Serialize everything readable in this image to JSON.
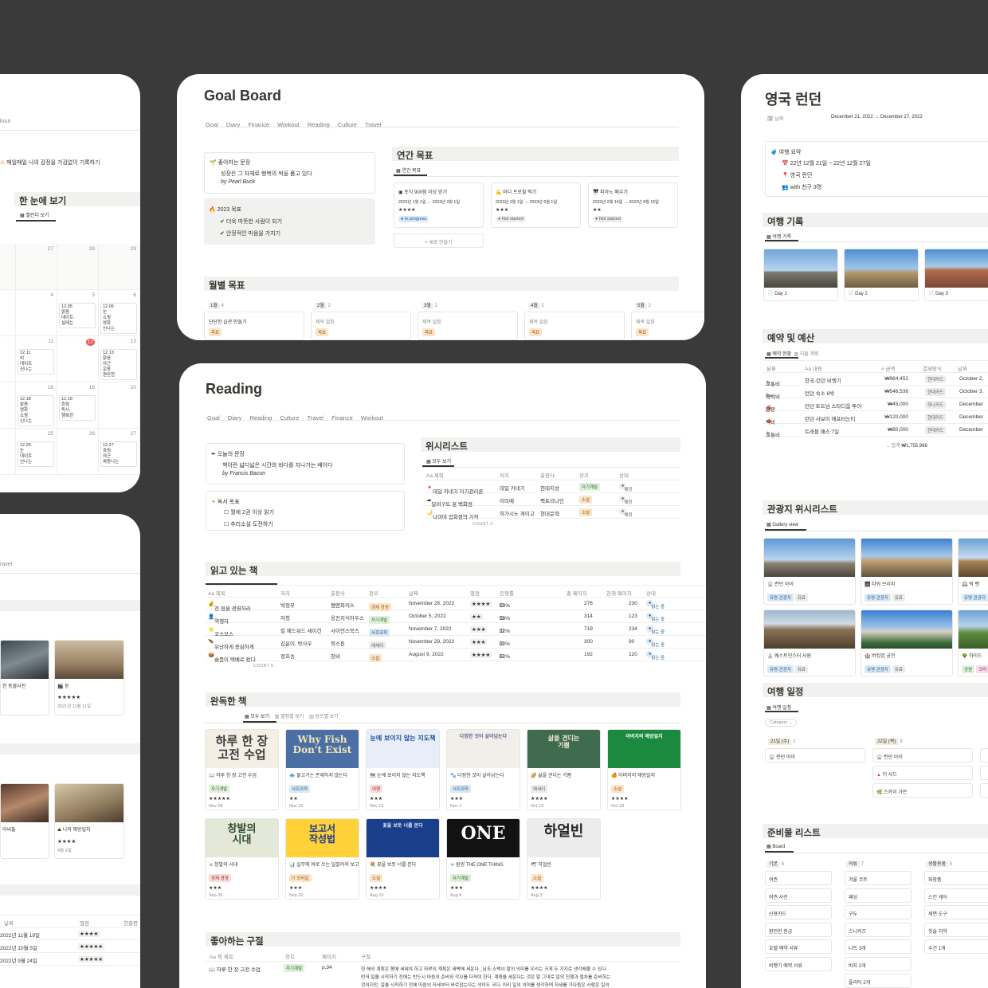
{
  "goal": {
    "title": "Goal Board",
    "tabs": [
      "Goal",
      "Diary",
      "Finance",
      "Workout",
      "Reading",
      "Culture",
      "Travel"
    ],
    "quote_title": "좋아하는 문장",
    "quote_text": "성장은 그 자체로 행복의 싹을 품고 있다",
    "quote_author": "by Pearl Buck",
    "goals_title": "2023 목표",
    "goals": [
      "더욱 따뜻한 사람이 되기",
      "안정적인 마음을 가지기"
    ],
    "annual_header": "연간 목표",
    "annual_view": "연간 목표",
    "annual_cards": [
      {
        "title": "토익 900점 이상 받기",
        "date": "2023년 1월 1일 → 2023년 3월 1일",
        "stars": "★★★★",
        "status": "In progress"
      },
      {
        "title": "바디 프로필 찍기",
        "date": "2023년 2월 1일 → 2023년 6월 1일",
        "stars": "★★★",
        "status": "Not started"
      },
      {
        "title": "피아노 배우기",
        "date": "2023년 2월 14일 → 2023년 8월 15일",
        "stars": "★★",
        "status": "Not started"
      }
    ],
    "new_label": "+ 새로 만들기",
    "monthly_header": "월별 목표",
    "months": [
      {
        "label": "1월",
        "count": "4",
        "item": "단단한 습관 만들기",
        "tag": "목표"
      },
      {
        "label": "2월",
        "count": "2",
        "item": "제목 없음",
        "tag": "목표"
      },
      {
        "label": "3월",
        "count": "2",
        "item": "제목 없음",
        "tag": "목표"
      },
      {
        "label": "4월",
        "count": "2",
        "item": "제목 없음",
        "tag": "목표"
      },
      {
        "label": "5월",
        "count": "2",
        "item": "제목 없음",
        "tag": "목표"
      }
    ]
  },
  "reading": {
    "title": "Reading",
    "tabs": [
      "Goal",
      "Diary",
      "Reading",
      "Culture",
      "Travel",
      "Finance",
      "Workout"
    ],
    "quote_title": "오늘의 문장",
    "quote_text": "책이란 넓디넓은 시간의 바다를 지나가는 배이다",
    "quote_author": "by Francis Bacon",
    "goal_title": "독서 목표",
    "goals": [
      "월에 2권 이상 읽기",
      "추리소설 도전하기"
    ],
    "wish_header": "위시리스트",
    "wish_view": "모두 보기",
    "wish_cols": [
      "Aa 제목",
      "저자",
      "출판사",
      "장르",
      "상태"
    ],
    "wish_rows": [
      [
        "데일 카네기 자기관리론",
        "데일 카네기",
        "현대지성",
        "자기계발",
        "예정"
      ],
      [
        "달러구트 꿈 백화점",
        "이미예",
        "팩토리나인",
        "소설",
        "예정"
      ],
      [
        "나미야 잡화점의 기적",
        "히가시노 게이고",
        "현대문학",
        "소설",
        "예정"
      ]
    ],
    "wish_count": "COUNT 3",
    "now_header": "읽고 있는 책",
    "now_cols": [
      "Aa 제목",
      "저자",
      "출판사",
      "장르",
      "날짜",
      "별점",
      "진행률",
      "총 페이지",
      "현재 페이지",
      "상태"
    ],
    "now_rows": [
      {
        "title": "천 원을 경영하라",
        "author": "박정부",
        "pub": "쌤앤파커스",
        "genre": [
          "경제 경영"
        ],
        "date": "November 28, 2022",
        "stars": "★★★★",
        "prog": "83%",
        "total": "276",
        "cur": "230",
        "status": "읽는 중"
      },
      {
        "title": "역행자",
        "author": "자청",
        "pub": "웅진지식하우스",
        "genre": [
          "자기계발"
        ],
        "date": "October 5, 2022",
        "stars": "★★",
        "prog": "39%",
        "total": "314",
        "cur": "123",
        "status": "읽는 중"
      },
      {
        "title": "코스모스",
        "author": "칼 에드워드 세이건",
        "pub": "사이언스북스",
        "genre": [
          "사회과학"
        ],
        "date": "November 7, 2022",
        "stars": "★★★",
        "prog": "32%",
        "total": "719",
        "cur": "234",
        "status": "읽는 중"
      },
      {
        "title": "유난하게 용감하게",
        "author": "김윤이, 박사우",
        "pub": "북스톤",
        "genre": [
          "여행",
          "에세이"
        ],
        "date": "November 29, 2022",
        "stars": "★★★",
        "prog": "30%",
        "total": "300",
        "cur": "90",
        "status": "읽는 중"
      },
      {
        "title": "슬픔이 택배로 왔다",
        "author": "정호승",
        "pub": "창비",
        "genre": [
          "소설"
        ],
        "date": "August 9, 2022",
        "stars": "★★★★",
        "prog": "62%",
        "total": "192",
        "cur": "120",
        "status": "읽는 중"
      }
    ],
    "now_count": "COUNT 5",
    "done_header": "완독한 책",
    "done_views": [
      "모두 보기",
      "별점별 보기",
      "장르별 보기"
    ],
    "books": [
      {
        "title": "하루 한 장 고전 수업",
        "tag": "자기계발",
        "stars": "★★★★★",
        "date": "Nov 28",
        "cover": "하루 한 장\n고전 수업"
      },
      {
        "title": "물고기는 존재하지 않는다",
        "tag": "사회과학",
        "stars": "★★",
        "date": "Nov 15",
        "cover": "Why Fish\nDon't Exist"
      },
      {
        "title": "눈에 보이지 않는 지도책",
        "tag": "여행",
        "stars": "★★★",
        "date": "Nov 15",
        "cover": "눈에 보이지 않는 지도책"
      },
      {
        "title": "다정한 것이 살아남는다",
        "tag": "사회과학",
        "stars": "★★★",
        "date": "Nov 1",
        "cover": "다정한 것이 살아남는다"
      },
      {
        "title": "삶을 견디는 기쁨",
        "tag": "에세이",
        "stars": "★★★★",
        "date": "Oct 19",
        "cover": "삶을 견디는\n기쁨"
      },
      {
        "title": "아버지의 해방일지",
        "tag": "소설",
        "stars": "★★★★",
        "date": "Oct 18",
        "cover": "아버지의 해방일지"
      },
      {
        "title": "창발의 시대",
        "tag": "경제 경영",
        "stars": "★★★",
        "date": "Sep 26",
        "cover": "창발의\n시대"
      },
      {
        "title": "실무에 바로 쓰는 일잘러의 보고서 작성법",
        "tag": "IT 모바일",
        "stars": "★★★",
        "date": "Sep 20",
        "cover": "보고서\n작성법"
      },
      {
        "title": "꽃을 보듯 너를 본다",
        "tag": "소설",
        "stars": "★★★★",
        "date": "Aug 10",
        "cover": "꽃을 보듯 너를 본다"
      },
      {
        "title": "원씽 THE ONE THING",
        "tag": "자기계발",
        "stars": "★★★",
        "date": "Aug 8",
        "cover": "ONE"
      },
      {
        "title": "히얼빈",
        "tag": "소설",
        "stars": "★★★★",
        "date": "Aug 3",
        "cover": "하얼빈"
      }
    ],
    "fav_header": "좋아하는 구절",
    "fav_cols": [
      "Aa 책 제목",
      "장르",
      "페이지",
      "구절"
    ],
    "fav_row": {
      "title": "하루 한 장 고전 수업",
      "genre": "자기계발",
      "page": "p.34",
      "text1": "한 해의 계획은 봄에 세워야 하고 하루의 계획은 새벽에 세운다._남조 소택이 말의 의미를 우리는 크게 두 가지로 생각해볼 수 있다.",
      "text2": "먼저 일을 시작하기 전에는 반드시 마음의 준비와 각오를 다져야 한다. 계획을 세운다는 것은 말 그대로 일의 진행과 절차를 준비하는",
      "text3": "것이지만, 일을 시작하기 전에 마음의 자세부터 바로잡는다는 의미도 크다. 미리 일의 의미를 생각하며 자세를 가다듬은 사람은 일의"
    }
  },
  "london": {
    "title": "영국 런던",
    "date_label": "날짜",
    "date_value": "December 21, 2022 → December 27, 2022",
    "summary_title": "여행 요약",
    "summary": [
      "22년 12월 21일 ~ 22년 12월 27일",
      "영국 런던",
      "with 친구 3명"
    ],
    "log_header": "여행 기록",
    "log_view": "여행 기록",
    "days": [
      "Day 1",
      "Day 2",
      "Day 3"
    ],
    "budget_header": "예약 및 예산",
    "budget_views": [
      "예약 현황",
      "지출 계획"
    ],
    "budget_cols": [
      "분류",
      "Aa 내용",
      "# 금액",
      "결제방식",
      "날짜"
    ],
    "budget_rows": [
      [
        "교통비",
        "한국-런던 비행기",
        "₩964,452",
        "현대카드",
        "October 2,"
      ],
      [
        "숙박비",
        "런던 숙소 6박",
        "₩546,536",
        "현대카드",
        "October 3,"
      ],
      [
        "관광",
        "런던 토트넘 스타디움 투어",
        "₩45,000",
        "하나카드",
        "December"
      ],
      [
        "식비",
        "런던 사보이 애프터눈티",
        "₩120,000",
        "현대카드",
        "December"
      ],
      [
        "교통비",
        "트래블 패스 7일",
        "₩80,000",
        "현대카드",
        "December"
      ]
    ],
    "budget_sum": "₩1,755,988",
    "sights_header": "관광지 위시리스트",
    "sights_view": "Gallery view",
    "sights": [
      {
        "name": "런던 아이",
        "tags": [
          "유명 관광지",
          "유료"
        ]
      },
      {
        "name": "타워 브리지",
        "tags": [
          "유명 관광지",
          "유료"
        ]
      },
      {
        "name": "빅 벤",
        "tags": [
          "유명 관광지"
        ]
      },
      {
        "name": "웨스트민스터 사원",
        "tags": [
          "유명 관광지",
          "유료"
        ]
      },
      {
        "name": "버킹엄 궁전",
        "tags": [
          "유명 관광지",
          "유료"
        ]
      },
      {
        "name": "하이드",
        "tags": [
          "공원",
          "크리"
        ]
      }
    ],
    "plan_header": "여행 일정",
    "plan_view": "여행 일정",
    "plan_filter": "Category",
    "plan_day1": "21일 (수)",
    "plan_day1_count": "1",
    "plan_day1_items": [
      "런던 아이"
    ],
    "plan_day2": "22일 (목)",
    "plan_day2_count": "3",
    "plan_day2_items": [
      "런던 아이",
      "더 샤드",
      "스카이 가든"
    ],
    "pack_header": "준비물 리스트",
    "pack_view": "Board",
    "pack_cols": [
      {
        "name": "기본",
        "count": "6",
        "items": [
          "여권",
          "여권 사진",
          "신용카드",
          "환전한 현금",
          "호텔 예약 서류",
          "비행기 예약 서류"
        ]
      },
      {
        "name": "의류",
        "count": "7",
        "items": [
          "겨울 코트",
          "패딩",
          "구두",
          "스니커즈",
          "니트 3개",
          "바지 2개",
          "플리티 2개"
        ]
      },
      {
        "name": "생활용품",
        "count": "5",
        "items": [
          "화장품",
          "스킨 케어",
          "세면 도구",
          "칫솔 치약",
          "수건 1개"
        ]
      }
    ]
  },
  "left_top": {
    "tab_fragment": "kout",
    "diary_line": "매일매일 나의 감정을 가감없이 기록하기",
    "view_header": "한 눈에 보기",
    "view_tab": "캘린더 보기",
    "dates": [
      "27",
      "28",
      "29",
      "4",
      "5",
      "6",
      "11",
      "12",
      "13",
      "18",
      "19",
      "20",
      "25",
      "26",
      "27"
    ],
    "events": {
      "d5": [
        "12.05",
        "맑음",
        "데이트",
        "설레는"
      ],
      "d6": [
        "12.06",
        "눈",
        "쇼핑",
        "영화",
        "신나는"
      ],
      "d11": [
        "12.11",
        "비",
        "데이트",
        "신나는"
      ],
      "d13": [
        "12.13",
        "맑음",
        "야근",
        "운동",
        "편안한"
      ],
      "d18": [
        "12.18",
        "맑음",
        "영화",
        "쇼핑",
        "신나는"
      ],
      "d19": [
        "12.19",
        "흐림",
        "독서",
        "행복한"
      ],
      "d25": [
        "12.25",
        "눈",
        "데이트",
        "신나는"
      ],
      "d27": [
        "12.27",
        "흐림",
        "야근",
        "짜증나는"
      ]
    }
  },
  "left_bottom": {
    "tab_fragment": "ravel",
    "movie1": "한 동물사전",
    "movie2": "듄",
    "movie2_stars": "★★★★★",
    "movie2_date": "2021년 11월 11일",
    "movie3": "아씨들",
    "movie4": "나의 해방일지",
    "movie4_stars": "★★★★",
    "movie4_date": "4월 9일",
    "cols": [
      "날짜",
      "별점",
      "한줄평"
    ],
    "rows": [
      [
        "2022년 11월 19일",
        "★★★★"
      ],
      [
        "2022년 10월 5일",
        "★★★★★"
      ],
      [
        "2022년 9월 24일",
        "★★★★★"
      ]
    ]
  },
  "colors": {
    "background": "#3a3a3a",
    "card": "#ffffff",
    "section": "#f1f1ef"
  }
}
